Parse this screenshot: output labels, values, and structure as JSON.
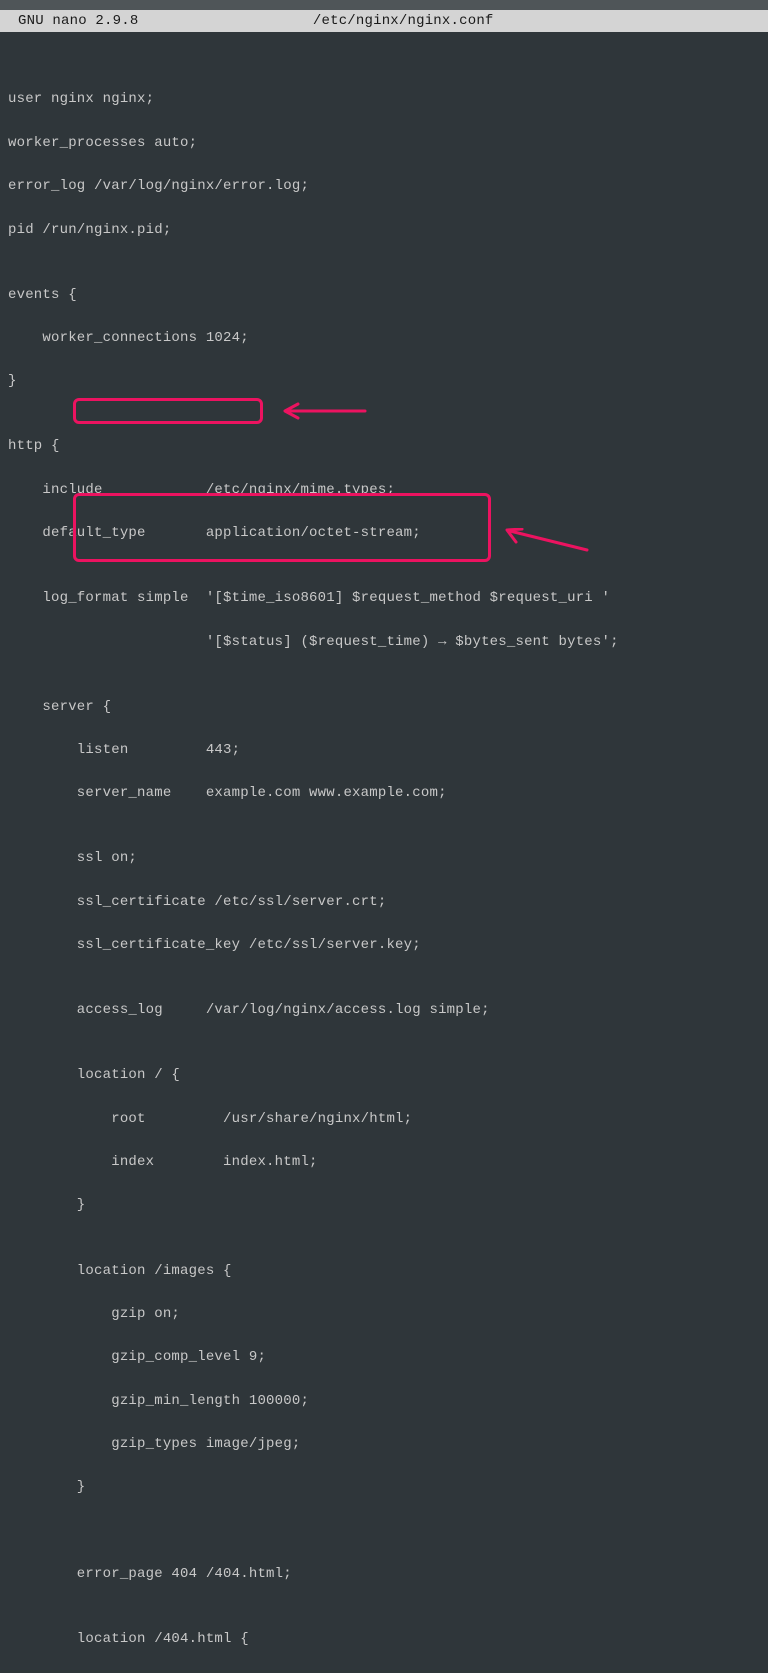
{
  "titlebar": {
    "app": "GNU nano 2.9.8",
    "filepath": "/etc/nginx/nginx.conf"
  },
  "lines": {
    "l0": "",
    "l1": "user nginx nginx;",
    "l2": "worker_processes auto;",
    "l3": "error_log /var/log/nginx/error.log;",
    "l4": "pid /run/nginx.pid;",
    "l5": "",
    "l6": "events {",
    "l7": "    worker_connections 1024;",
    "l8": "}",
    "l9": "",
    "l10": "http {",
    "l11": "    include            /etc/nginx/mime.types;",
    "l12": "    default_type       application/octet-stream;",
    "l13": "",
    "l14": "    log_format simple  '[$time_iso8601] $request_method $request_uri '",
    "l15": "                       '[$status] ($request_time) → $bytes_sent bytes';",
    "l16": "",
    "l17": "    server {",
    "l18": "        listen         443;",
    "l19": "        server_name    example.com www.example.com;",
    "l20": "",
    "l21": "        ssl on;",
    "l22": "        ssl_certificate /etc/ssl/server.crt;",
    "l23": "        ssl_certificate_key /etc/ssl/server.key;",
    "l24": "",
    "l25": "        access_log     /var/log/nginx/access.log simple;",
    "l26": "",
    "l27": "        location / {",
    "l28": "            root         /usr/share/nginx/html;",
    "l29": "            index        index.html;",
    "l30": "        }",
    "l31": "",
    "l32": "        location /images {",
    "l33": "            gzip on;",
    "l34": "            gzip_comp_level 9;",
    "l35": "            gzip_min_length 100000;",
    "l36": "            gzip_types image/jpeg;",
    "l37": "        }",
    "l38": "",
    "l39": "",
    "l40": "        error_page 404 /404.html;",
    "l41": "",
    "l42": "        location /404.html {"
  },
  "annotations": {
    "highlight_color": "#ec1360"
  }
}
